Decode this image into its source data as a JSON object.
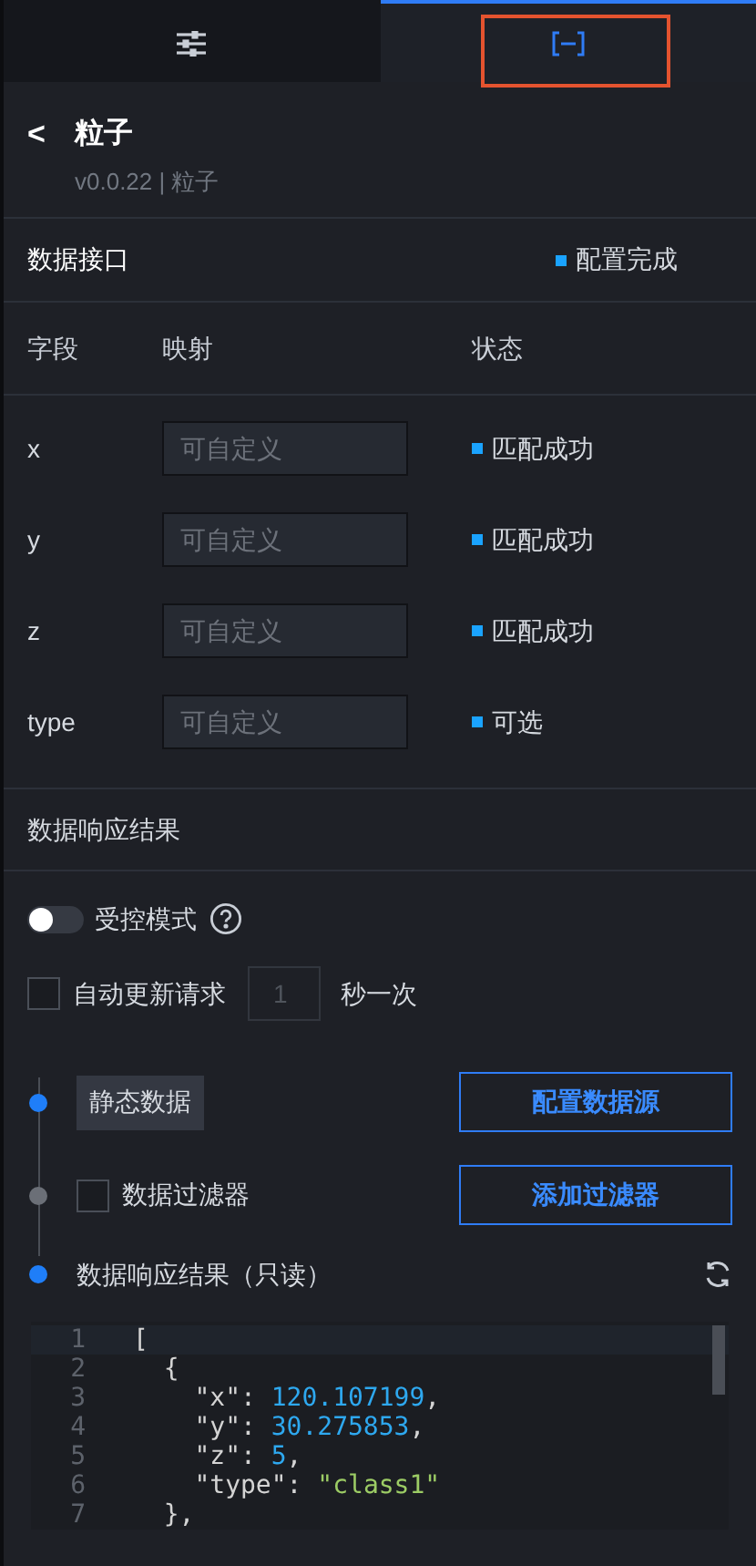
{
  "tabs": [
    {
      "kind": "settings",
      "selected": false,
      "highlighted": false
    },
    {
      "kind": "data",
      "selected": true,
      "highlighted": true
    }
  ],
  "header": {
    "back": "<",
    "title": "粒子",
    "subtitle": "v0.0.22 | 粒子"
  },
  "interface": {
    "title": "数据接口",
    "status": "配置完成"
  },
  "fields": {
    "columns": [
      "字段",
      "映射",
      "状态"
    ],
    "rows": [
      {
        "field": "x",
        "placeholder": "可自定义",
        "status": "匹配成功"
      },
      {
        "field": "y",
        "placeholder": "可自定义",
        "status": "匹配成功"
      },
      {
        "field": "z",
        "placeholder": "可自定义",
        "status": "匹配成功"
      },
      {
        "field": "type",
        "placeholder": "可自定义",
        "status": "可选"
      }
    ]
  },
  "response": {
    "title": "数据响应结果",
    "controlled_mode": {
      "label": "受控模式",
      "on": false
    },
    "auto_update": {
      "label": "自动更新请求",
      "checked": false,
      "placeholder": "1",
      "unit": "秒一次"
    },
    "steps": [
      {
        "kind": "source",
        "active": true,
        "tag": "静态数据",
        "button": "配置数据源"
      },
      {
        "kind": "filter",
        "active": false,
        "label": "数据过滤器",
        "checked": false,
        "button": "添加过滤器"
      },
      {
        "kind": "result",
        "active": true,
        "label": "数据响应结果（只读）"
      }
    ]
  },
  "code": {
    "lines": [
      {
        "number": "1",
        "tokens": [
          {
            "kind": "punct",
            "text": "["
          }
        ]
      },
      {
        "number": "2",
        "tokens": [
          {
            "kind": "punct",
            "text": "  {"
          }
        ]
      },
      {
        "number": "3",
        "tokens": [
          {
            "kind": "key",
            "text": "    \"x\": "
          },
          {
            "kind": "number",
            "text": "120.107199"
          },
          {
            "kind": "punct",
            "text": ","
          }
        ]
      },
      {
        "number": "4",
        "tokens": [
          {
            "kind": "key",
            "text": "    \"y\": "
          },
          {
            "kind": "number",
            "text": "30.275853"
          },
          {
            "kind": "punct",
            "text": ","
          }
        ]
      },
      {
        "number": "5",
        "tokens": [
          {
            "kind": "key",
            "text": "    \"z\": "
          },
          {
            "kind": "number",
            "text": "5"
          },
          {
            "kind": "punct",
            "text": ","
          }
        ]
      },
      {
        "number": "6",
        "tokens": [
          {
            "kind": "key",
            "text": "    \"type\": "
          },
          {
            "kind": "string",
            "text": "\"class1\""
          }
        ]
      },
      {
        "number": "7",
        "tokens": [
          {
            "kind": "punct",
            "text": "  },"
          }
        ]
      }
    ]
  }
}
